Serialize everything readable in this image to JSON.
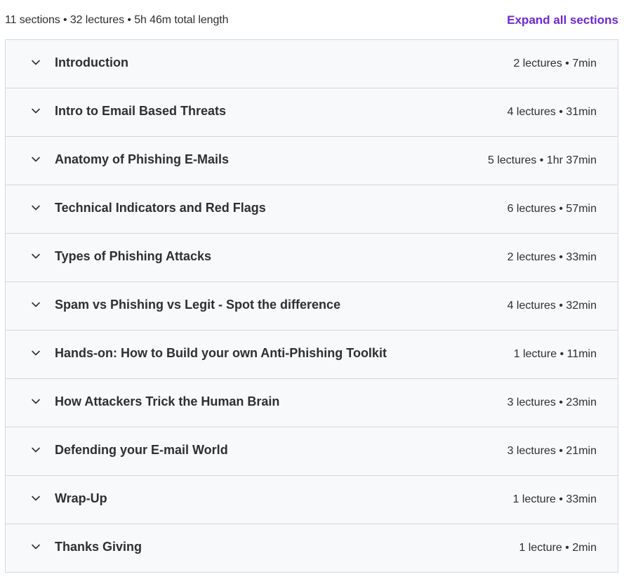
{
  "header": {
    "summary": "11 sections • 32 lectures • 5h 46m total length",
    "expand_all_label": "Expand all sections"
  },
  "colors": {
    "accent": "#6d28d2",
    "row_background": "#f7f9fa",
    "border": "#d1d7dc",
    "text": "#2d2f31"
  },
  "icons": {
    "section_toggle": "chevron-down-icon"
  },
  "sections": [
    {
      "title": "Introduction",
      "meta": "2 lectures • 7min"
    },
    {
      "title": "Intro to Email Based Threats",
      "meta": "4 lectures • 31min"
    },
    {
      "title": "Anatomy of Phishing E-Mails",
      "meta": "5 lectures • 1hr 37min"
    },
    {
      "title": "Technical Indicators and Red Flags",
      "meta": "6 lectures • 57min"
    },
    {
      "title": "Types of Phishing Attacks",
      "meta": "2 lectures • 33min"
    },
    {
      "title": "Spam vs Phishing vs Legit - Spot the difference",
      "meta": "4 lectures • 32min"
    },
    {
      "title": "Hands-on: How to Build your own Anti-Phishing Toolkit",
      "meta": "1 lecture • 11min"
    },
    {
      "title": "How Attackers Trick the Human Brain",
      "meta": "3 lectures • 23min"
    },
    {
      "title": "Defending your E-mail World",
      "meta": "3 lectures • 21min"
    },
    {
      "title": "Wrap-Up",
      "meta": "1 lecture • 33min"
    },
    {
      "title": "Thanks Giving",
      "meta": "1 lecture • 2min"
    }
  ]
}
